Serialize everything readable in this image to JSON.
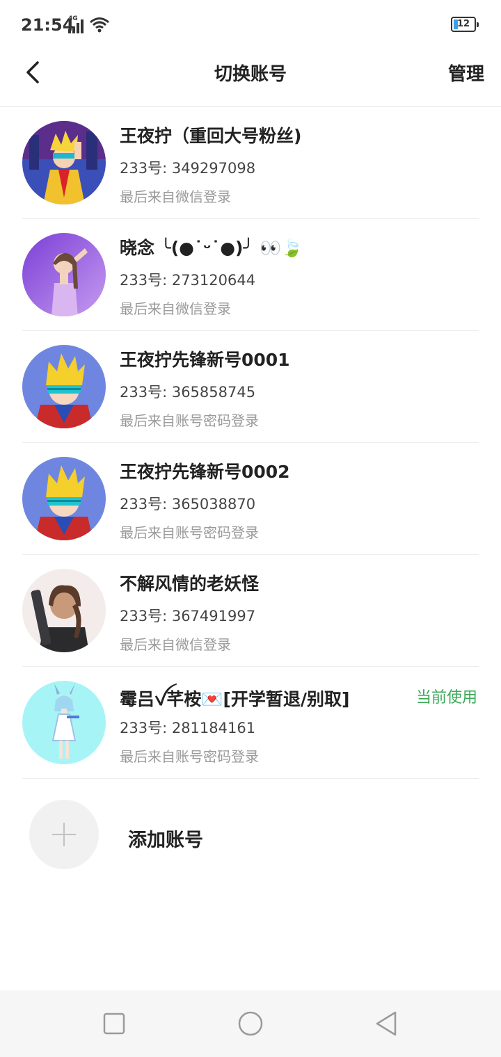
{
  "status_bar": {
    "time": "21:54",
    "network": "4G",
    "battery": "12"
  },
  "header": {
    "title": "切换账号",
    "manage": "管理"
  },
  "accounts": [
    {
      "name": "王夜拧（重回大号粉丝)",
      "uid": "233号: 349297098",
      "login_via": "最后来自微信登录",
      "avatar_icon": "avatar-yellow-hair-hero"
    },
    {
      "name": "晓念 ╰(●˙ᵕ˙●)╯ 👀🍃",
      "uid": "233号: 273120644",
      "login_via": "最后来自微信登录",
      "avatar_icon": "avatar-saluting-girl"
    },
    {
      "name": "王夜拧先锋新号0001",
      "uid": "233号: 365858745",
      "login_via": "最后来自账号密码登录",
      "avatar_icon": "avatar-visor-hero"
    },
    {
      "name": "王夜拧先锋新号0002",
      "uid": "233号: 365038870",
      "login_via": "最后来自账号密码登录",
      "avatar_icon": "avatar-visor-hero"
    },
    {
      "name": "不解风情的老妖怪",
      "uid": "233号: 367491997",
      "login_via": "最后来自微信登录",
      "avatar_icon": "avatar-braided-girl"
    },
    {
      "name": "霉吕ꪜ芊桉💌[开学暂退/别取]",
      "uid": "233号: 281184161",
      "login_via": "最后来自账号密码登录",
      "avatar_icon": "avatar-bunny-girl",
      "badge": "当前使用"
    }
  ],
  "add_account": {
    "label": "添加账号"
  },
  "colors": {
    "current_badge": "#3aa957",
    "divider": "#ececec",
    "secondary_text": "#9a9a9a"
  }
}
